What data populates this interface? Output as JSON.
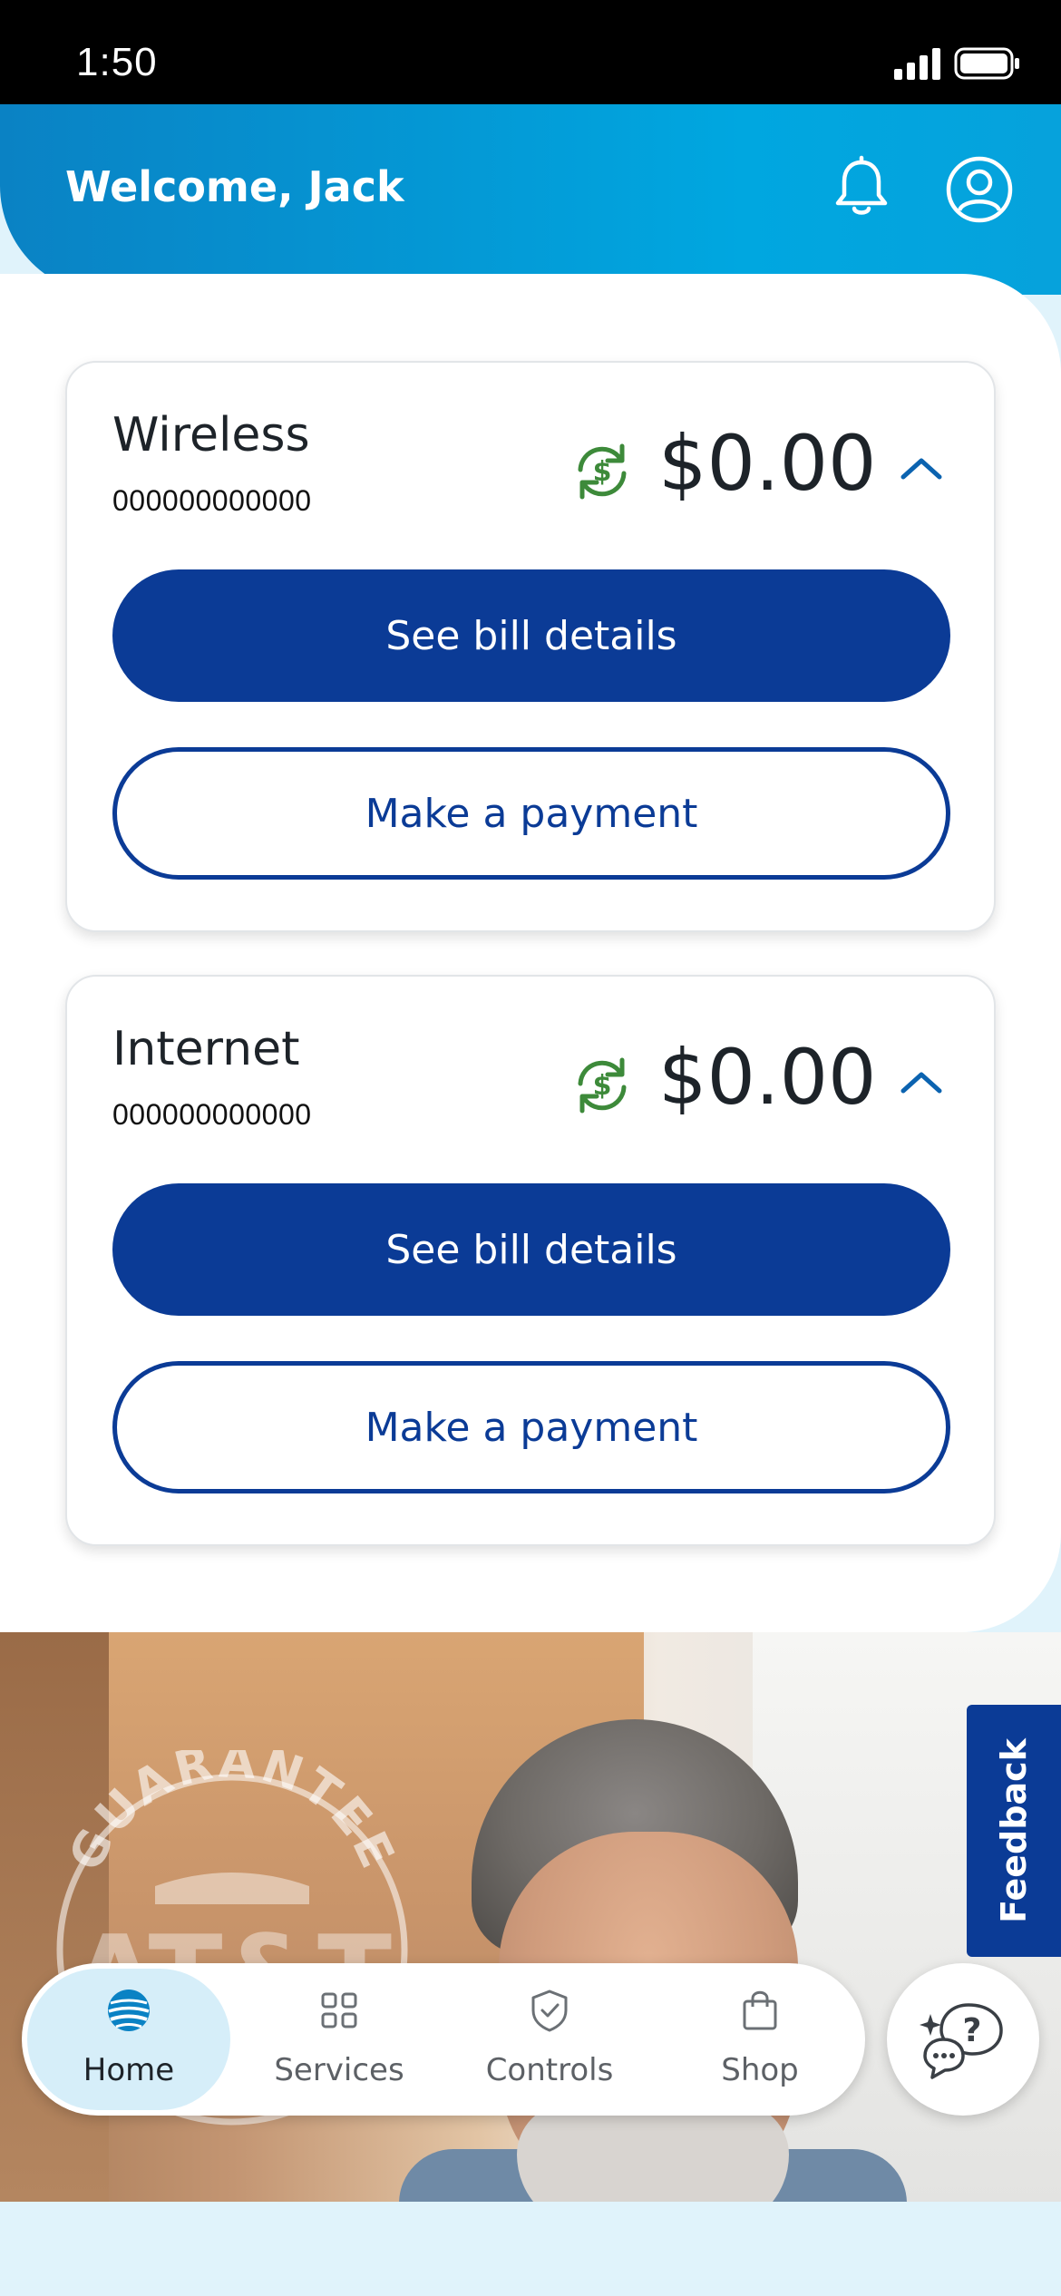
{
  "status_bar": {
    "time": "1:50"
  },
  "header": {
    "welcome": "Welcome, Jack"
  },
  "accounts": [
    {
      "title": "Wireless",
      "account_number": "000000000000",
      "amount": "$0.00",
      "primary_button": "See bill details",
      "secondary_button": "Make a payment"
    },
    {
      "title": "Internet",
      "account_number": "000000000000",
      "amount": "$0.00",
      "primary_button": "See bill details",
      "secondary_button": "Make a payment"
    }
  ],
  "promo": {
    "logo_text_top": "GUARANTEE",
    "logo_text_main": "AT&T"
  },
  "feedback": {
    "label": "Feedback"
  },
  "nav": {
    "items": [
      {
        "label": "Home",
        "icon": "att-globe-icon",
        "active": true
      },
      {
        "label": "Services",
        "icon": "grid-icon",
        "active": false
      },
      {
        "label": "Controls",
        "icon": "shield-check-icon",
        "active": false
      },
      {
        "label": "Shop",
        "icon": "shopping-bag-icon",
        "active": false
      }
    ]
  },
  "colors": {
    "brand_blue": "#0b3b96",
    "header_cyan": "#00a7e0",
    "autopay_green": "#3d8a3a",
    "nav_active": "#d6eef9"
  }
}
